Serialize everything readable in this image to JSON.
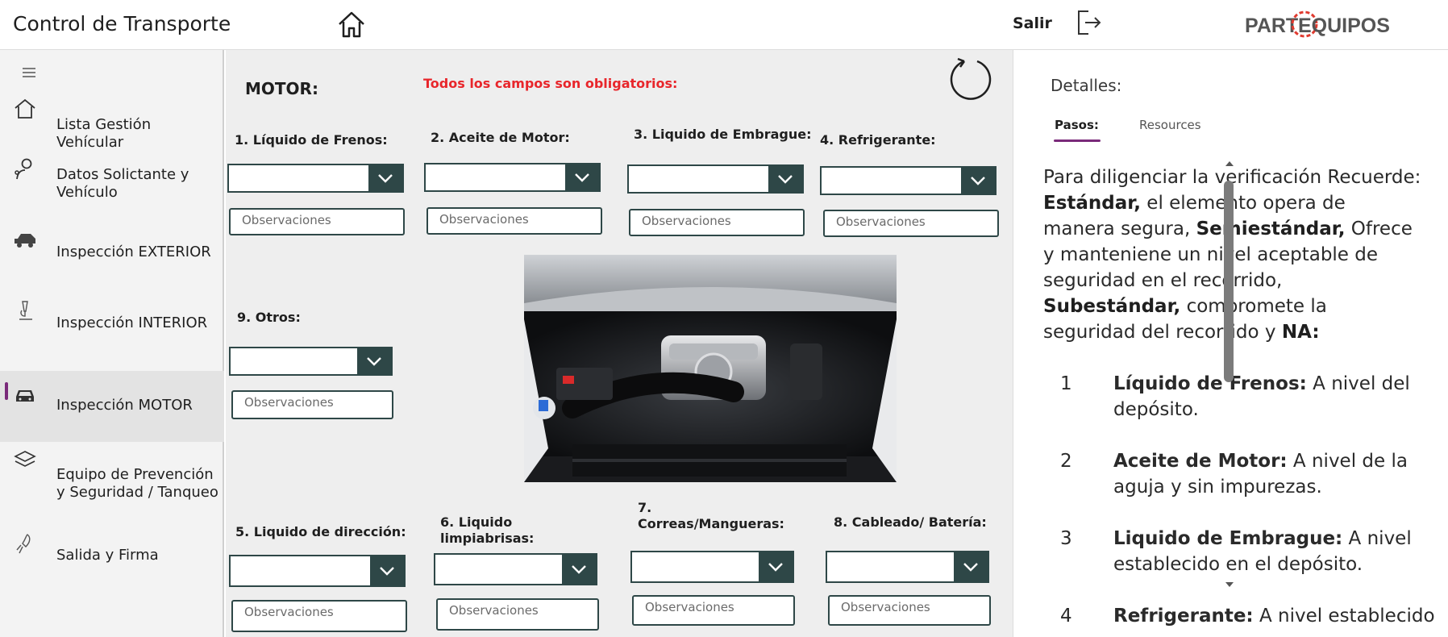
{
  "header": {
    "app_title": "Control de Transporte",
    "logout_label": "Salir",
    "logo_text": "PARTEQUIPOS"
  },
  "nav": {
    "items": [
      {
        "label": "Lista  Gestión Vehícular",
        "icon": "home-icon"
      },
      {
        "label": "Datos Solictante y Vehículo",
        "icon": "user-icon"
      },
      {
        "label": "Inspección EXTERIOR",
        "icon": "truck-icon"
      },
      {
        "label": "Inspección INTERIOR",
        "icon": "microscope-icon"
      },
      {
        "label": "Inspección MOTOR",
        "icon": "car-icon",
        "active": true
      },
      {
        "label": "Equipo de Prevención y Seguridad / Tanqueo",
        "icon": "layers-icon"
      },
      {
        "label": "Salida y Firma",
        "icon": "rocket-icon"
      }
    ]
  },
  "form": {
    "section_title": "MOTOR:",
    "required_note": "Todos los campos son obligatorios:",
    "observations_placeholder": "Observaciones",
    "fields": [
      {
        "label": "1. Líquido de Frenos:"
      },
      {
        "label": "2. Aceite de Motor:"
      },
      {
        "label": "3. Liquido de Embrague:"
      },
      {
        "label": "4. Refrigerante:"
      },
      {
        "label": "9. Otros:"
      },
      {
        "label": "5. Liquido de dirección:"
      },
      {
        "label": "6. Liquido limpiabrisas:"
      },
      {
        "label": "7. Correas/Mangueras:"
      },
      {
        "label": "8. Cableado/ Batería:"
      }
    ]
  },
  "details": {
    "title": "Detalles:",
    "tabs": [
      "Pasos:",
      "Resources"
    ],
    "intro_lead": "Para diligenciar la verificación Recuerde:",
    "intro_parts": [
      {
        "term": "Estándar,",
        "text": " el elemento opera de manera segura, "
      },
      {
        "term": "Semiestándar,",
        "text": " Ofrece y manteniene un nivel aceptable de seguridad en el recorrido, "
      },
      {
        "term": "Subestándar,",
        "text": " compromete la seguridad del recorrido y "
      },
      {
        "term": "NA:",
        "text": ""
      }
    ],
    "steps": [
      {
        "num": "1",
        "term": "Líquido de Frenos:",
        "text": " A nivel del depósito."
      },
      {
        "num": "2",
        "term": "Aceite de Motor:",
        "text": " A nivel de la aguja y sin impurezas."
      },
      {
        "num": "3",
        "term": "Liquido de Embrague:",
        "text": " A nivel establecido en el depósito."
      },
      {
        "num": "4",
        "term": "Refrigerante:",
        "text": " A nivel establecido en"
      }
    ]
  },
  "colors": {
    "accent": "#7a2a7a",
    "dropdown_dark": "#2e4747",
    "required_red": "#e8262b",
    "logo_red": "#e03a2f"
  }
}
